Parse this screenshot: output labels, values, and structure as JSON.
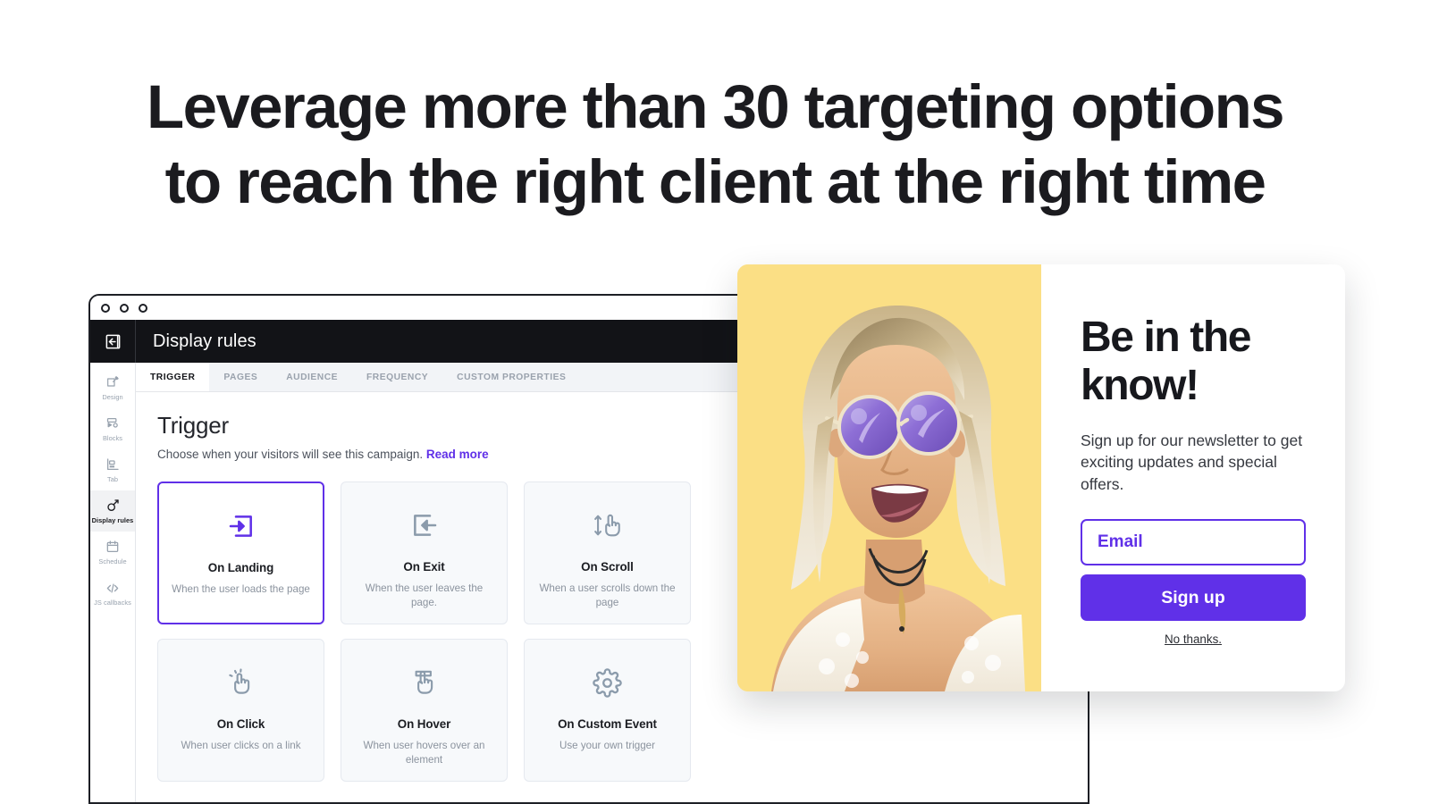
{
  "headline": {
    "line1": "Leverage more than 30 targeting options",
    "line2": "to reach the right client at the right time"
  },
  "colors": {
    "accent_purple": "#6030e8",
    "photo_yellow": "#fbdf85",
    "appbar_dark": "#121317",
    "card_bg": "#f7f9fb",
    "muted_text": "#8b939e"
  },
  "browser": {
    "appbar": {
      "back_icon": "collapse-panel-icon",
      "title": "Display rules"
    },
    "rail": {
      "items": [
        {
          "label": "Design",
          "icon": "design-pencil-icon",
          "active": false
        },
        {
          "label": "Blocks",
          "icon": "blocks-icon",
          "active": false
        },
        {
          "label": "Tab",
          "icon": "tab-icon",
          "active": false
        },
        {
          "label": "Display rules",
          "icon": "target-arrow-icon",
          "active": true
        },
        {
          "label": "Schedule",
          "icon": "calendar-icon",
          "active": false
        },
        {
          "label": "JS callbacks",
          "icon": "code-brackets-icon",
          "active": false
        }
      ]
    },
    "tabs": [
      {
        "label": "TRIGGER",
        "active": true
      },
      {
        "label": "PAGES",
        "active": false
      },
      {
        "label": "AUDIENCE",
        "active": false
      },
      {
        "label": "FREQUENCY",
        "active": false
      },
      {
        "label": "CUSTOM PROPERTIES",
        "active": false
      }
    ],
    "panel": {
      "title": "Trigger",
      "subtitle": "Choose when your visitors will see this campaign.",
      "read_more": "Read more"
    },
    "triggers": [
      {
        "name": "On Landing",
        "description": "When the user loads the page",
        "icon": "arrow-into-box-icon",
        "selected": true
      },
      {
        "name": "On Exit",
        "description": "When the user leaves the page.",
        "icon": "arrow-out-of-box-icon",
        "selected": false
      },
      {
        "name": "On Scroll",
        "description": "When a user scrolls down the page",
        "icon": "hand-scroll-icon",
        "selected": false
      },
      {
        "name": "On Click",
        "description": "When user clicks on a link",
        "icon": "hand-click-icon",
        "selected": false
      },
      {
        "name": "On Hover",
        "description": "When user hovers over an element",
        "icon": "hand-hover-icon",
        "selected": false
      },
      {
        "name": "On Custom Event",
        "description": "Use your own trigger",
        "icon": "gear-icon",
        "selected": false
      }
    ]
  },
  "popup": {
    "photo_alt": "smiling-woman-with-round-sunglasses",
    "title": "Be in the know!",
    "subtitle": "Sign up for our newsletter to get exciting updates and special offers.",
    "email_placeholder": "Email",
    "email_value": "",
    "signup_label": "Sign up",
    "decline_label": "No thanks."
  }
}
